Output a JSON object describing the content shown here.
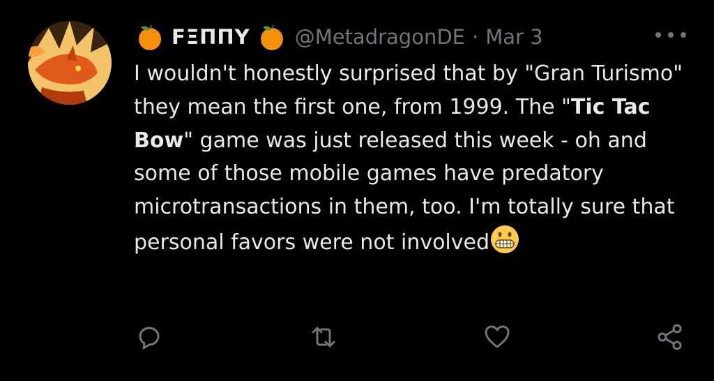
{
  "tweet": {
    "author": {
      "display_name": "FΞПΠY",
      "handle": "@MetadragonDE"
    },
    "separator": "·",
    "date": "Mar 3",
    "body": {
      "line1": "I wouldn't honestly surprised that by \"Gran Turismo\" they mean the first one, from 1999.",
      "pre_bold": "The \"",
      "bold": "Tic Tac Bow",
      "post_bold": "\" game was just released this week - oh and some of those mobile games have predatory microtransactions in them, too.",
      "line_last": "I'm totally sure that personal favors were not involved"
    },
    "icons": {
      "orange_emoji": "tangerine-icon",
      "grimace_emoji": "grimacing-face-icon",
      "reply": "reply-icon",
      "retweet": "retweet-icon",
      "like": "heart-icon",
      "share": "share-icon",
      "more": "more-icon"
    },
    "colors": {
      "background": "#000000",
      "text": "#e7e9ea",
      "secondary": "#71767b",
      "orange": "#f4900c"
    }
  }
}
